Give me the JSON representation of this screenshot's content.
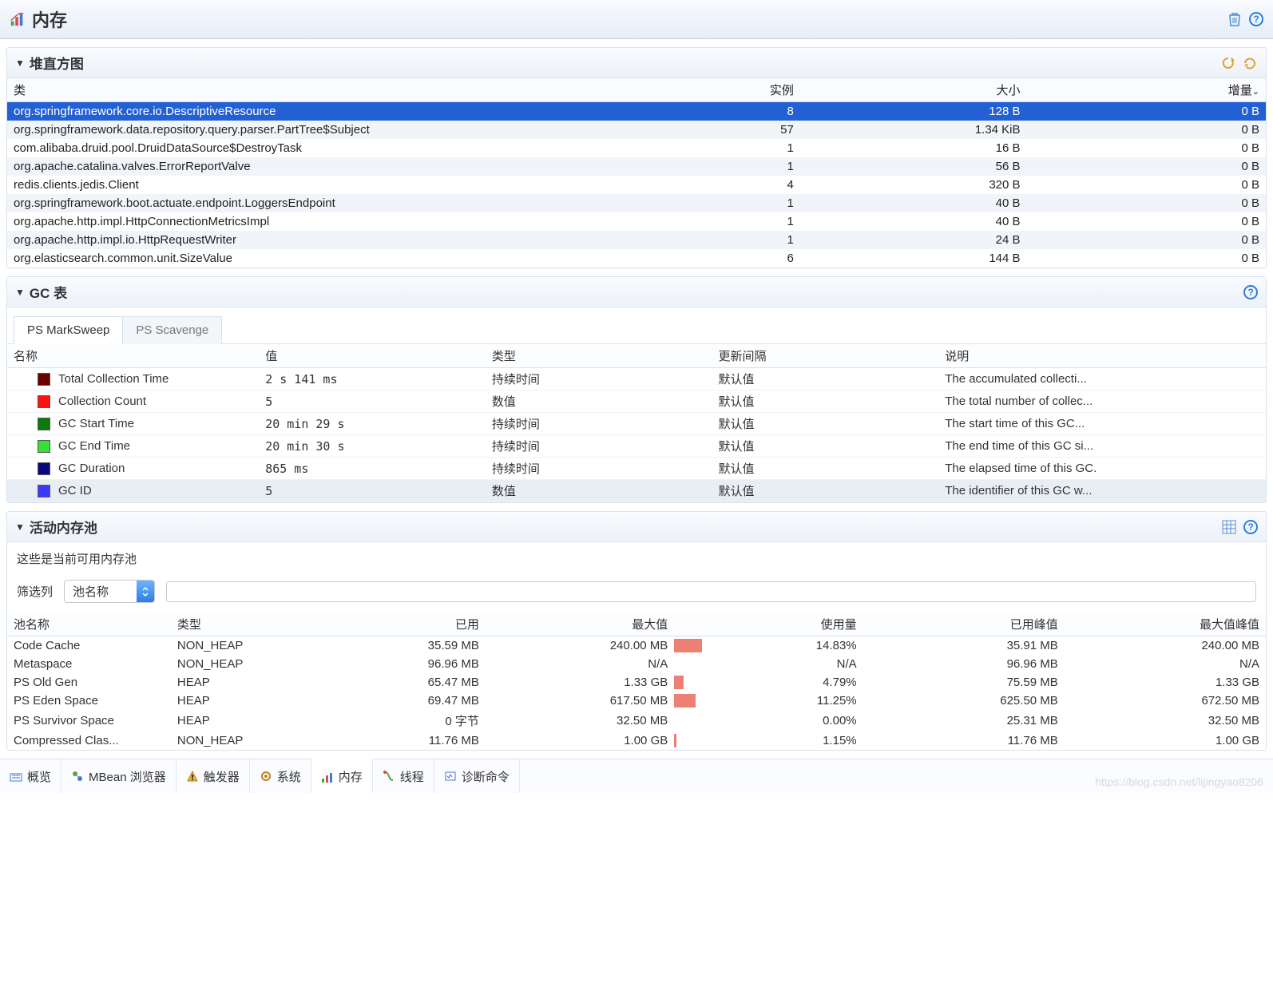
{
  "header": {
    "title": "内存"
  },
  "heap_histogram": {
    "title": "堆直方图",
    "columns": {
      "class": "类",
      "instances": "实例",
      "size": "大小",
      "delta": "增量"
    },
    "rows": [
      {
        "class": "org.springframework.core.io.DescriptiveResource",
        "instances": "8",
        "size": "128 B",
        "delta": "0 B",
        "selected": true
      },
      {
        "class": "org.springframework.data.repository.query.parser.PartTree$Subject",
        "instances": "57",
        "size": "1.34 KiB",
        "delta": "0 B"
      },
      {
        "class": "com.alibaba.druid.pool.DruidDataSource$DestroyTask",
        "instances": "1",
        "size": "16 B",
        "delta": "0 B"
      },
      {
        "class": "org.apache.catalina.valves.ErrorReportValve",
        "instances": "1",
        "size": "56 B",
        "delta": "0 B"
      },
      {
        "class": "redis.clients.jedis.Client",
        "instances": "4",
        "size": "320 B",
        "delta": "0 B"
      },
      {
        "class": "org.springframework.boot.actuate.endpoint.LoggersEndpoint",
        "instances": "1",
        "size": "40 B",
        "delta": "0 B"
      },
      {
        "class": "org.apache.http.impl.HttpConnectionMetricsImpl",
        "instances": "1",
        "size": "40 B",
        "delta": "0 B"
      },
      {
        "class": "org.apache.http.impl.io.HttpRequestWriter",
        "instances": "1",
        "size": "24 B",
        "delta": "0 B"
      },
      {
        "class": "org.elasticsearch.common.unit.SizeValue",
        "instances": "6",
        "size": "144 B",
        "delta": "0 B"
      }
    ]
  },
  "gc": {
    "title": "GC 表",
    "tabs": [
      "PS MarkSweep",
      "PS Scavenge"
    ],
    "columns": {
      "name": "名称",
      "value": "值",
      "type": "类型",
      "interval": "更新间隔",
      "desc": "说明"
    },
    "rows": [
      {
        "color": "#6b0000",
        "name": "Total Collection Time",
        "value": "2 s 141 ms",
        "type": "持续时间",
        "interval": "默认值",
        "desc": "The accumulated collecti..."
      },
      {
        "color": "#ff1212",
        "name": "Collection Count",
        "value": "5",
        "type": "数值",
        "interval": "默认值",
        "desc": "The total number of collec..."
      },
      {
        "color": "#0a7a0a",
        "name": "GC Start Time",
        "value": "20 min 29 s",
        "type": "持续时间",
        "interval": "默认值",
        "desc": "The start time of this GC..."
      },
      {
        "color": "#35e035",
        "name": "GC End Time",
        "value": "20 min 30 s",
        "type": "持续时间",
        "interval": "默认值",
        "desc": "The end time of this GC si..."
      },
      {
        "color": "#0a0a80",
        "name": "GC Duration",
        "value": "865 ms",
        "type": "持续时间",
        "interval": "默认值",
        "desc": "The elapsed time of this GC."
      },
      {
        "color": "#3a3aff",
        "name": "GC ID",
        "value": "5",
        "type": "数值",
        "interval": "默认值",
        "desc": "The identifier of this GC w..."
      }
    ]
  },
  "pools": {
    "title": "活动内存池",
    "desc": "这些是当前可用内存池",
    "filter_label": "筛选列",
    "filter_select": "池名称",
    "columns": {
      "name": "池名称",
      "type": "类型",
      "used": "已用",
      "max": "最大值",
      "usage": "使用量",
      "peak_used": "已用峰值",
      "peak_max": "最大值峰值"
    },
    "rows": [
      {
        "name": "Code Cache",
        "type": "NON_HEAP",
        "used": "35.59 MB",
        "max": "240.00 MB",
        "usage": "14.83%",
        "bar": 14.83,
        "peak_used": "35.91 MB",
        "peak_max": "240.00 MB"
      },
      {
        "name": "Metaspace",
        "type": "NON_HEAP",
        "used": "96.96 MB",
        "max": "N/A",
        "usage": "N/A",
        "bar": 0,
        "peak_used": "96.96 MB",
        "peak_max": "N/A"
      },
      {
        "name": "PS Old Gen",
        "type": "HEAP",
        "used": "65.47 MB",
        "max": "1.33 GB",
        "usage": "4.79%",
        "bar": 4.79,
        "peak_used": "75.59 MB",
        "peak_max": "1.33 GB"
      },
      {
        "name": "PS Eden Space",
        "type": "HEAP",
        "used": "69.47 MB",
        "max": "617.50 MB",
        "usage": "11.25%",
        "bar": 11.25,
        "peak_used": "625.50 MB",
        "peak_max": "672.50 MB"
      },
      {
        "name": "PS Survivor Space",
        "type": "HEAP",
        "used": "0 字节",
        "max": "32.50 MB",
        "usage": "0.00%",
        "bar": 0,
        "peak_used": "25.31 MB",
        "peak_max": "32.50 MB"
      },
      {
        "name": "Compressed Clas...",
        "type": "NON_HEAP",
        "used": "11.76 MB",
        "max": "1.00 GB",
        "usage": "1.15%",
        "bar": 1.15,
        "peak_used": "11.76 MB",
        "peak_max": "1.00 GB"
      }
    ]
  },
  "bottom_tabs": {
    "overview": "概览",
    "mbean": "MBean 浏览器",
    "trigger": "触发器",
    "system": "系统",
    "memory": "内存",
    "threads": "线程",
    "diag": "诊断命令"
  },
  "watermark": "https://blog.csdn.net/lijingyao8206"
}
